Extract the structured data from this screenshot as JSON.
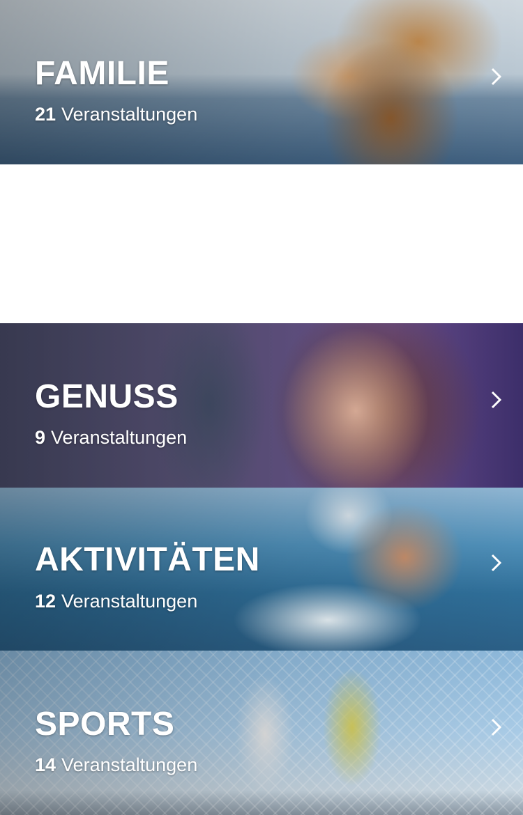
{
  "categories": [
    {
      "title": "FAMILIE",
      "count": "21",
      "count_label": "Veranstaltungen",
      "icon": "chevron-right-icon"
    },
    {
      "title": "GENUSS",
      "count": "9",
      "count_label": "Veranstaltungen",
      "icon": "chevron-right-icon"
    },
    {
      "title": "AKTIVITÄTEN",
      "count": "12",
      "count_label": "Veranstaltungen",
      "icon": "chevron-right-icon"
    },
    {
      "title": "SPORTS",
      "count": "14",
      "count_label": "Veranstaltungen",
      "icon": "chevron-right-icon"
    }
  ],
  "colors": {
    "text": "#ffffff",
    "background": "#ffffff"
  }
}
